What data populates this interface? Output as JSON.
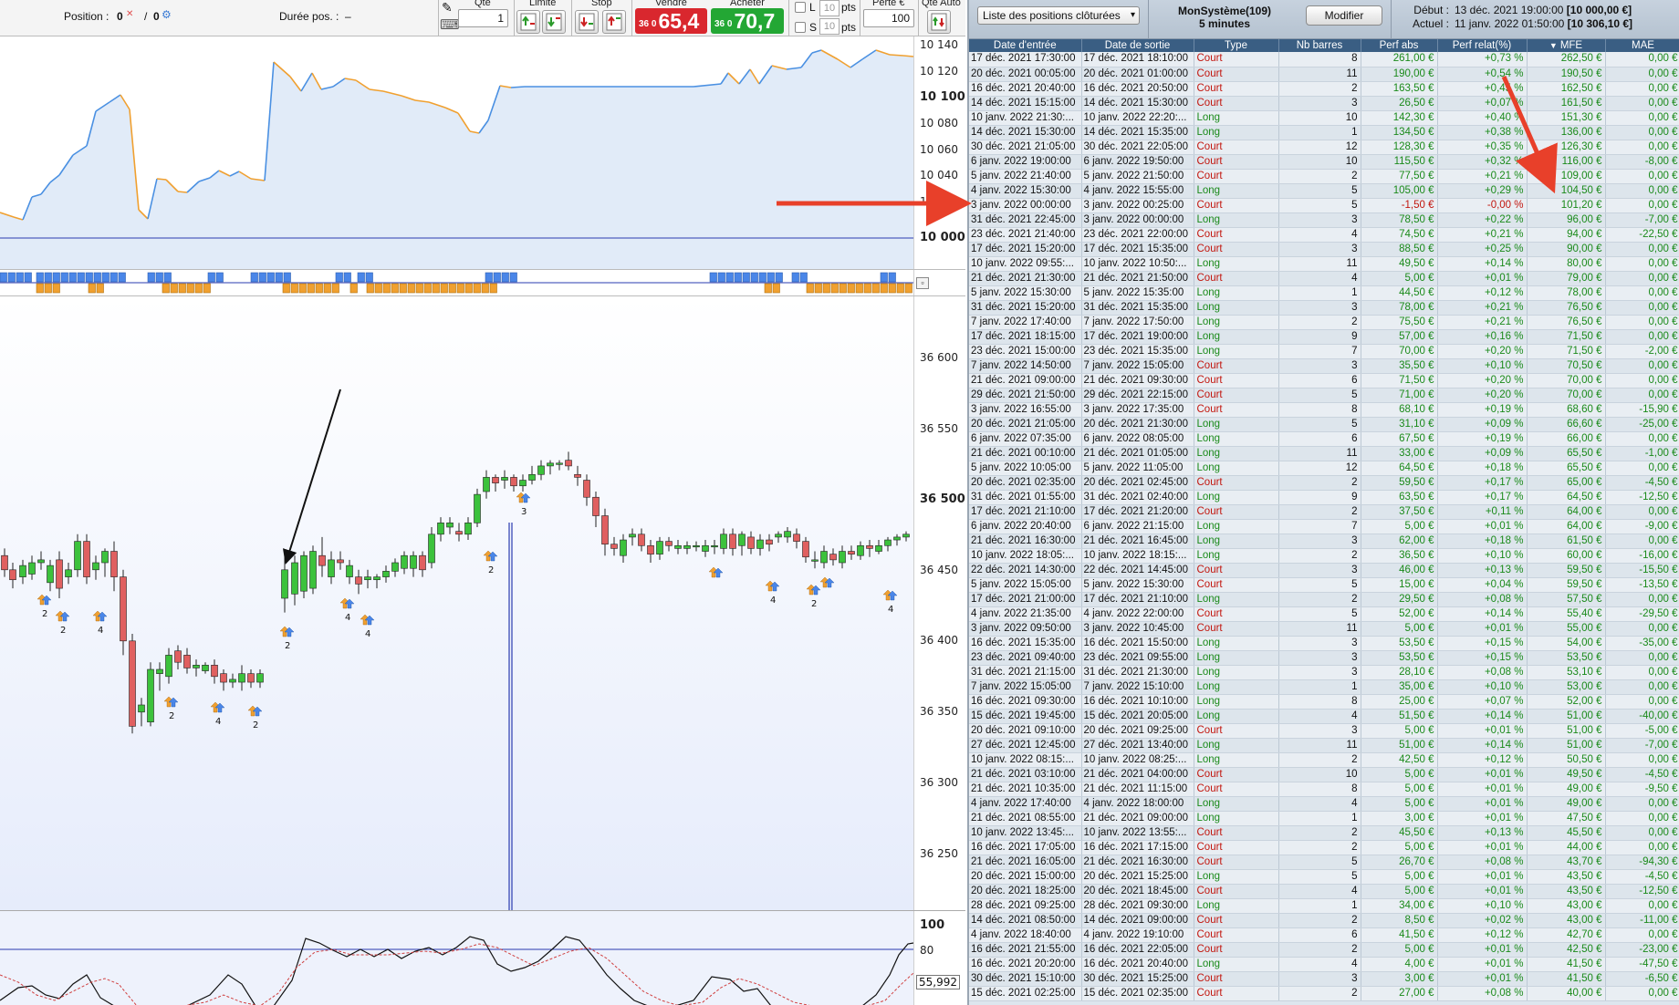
{
  "toolbar": {
    "position_label": "Position :",
    "position_value": "0",
    "position_value2": "0",
    "duration_label": "Durée pos. :",
    "duration_value": "–",
    "qty_label": "Qté",
    "qty_value": "1",
    "limit_label": "Limite",
    "stop_label": "Stop",
    "sell_label": "Vendre",
    "sell_prefix": "36 0",
    "sell_price": "65,4",
    "buy_label": "Acheter",
    "buy_prefix": "36 0",
    "buy_price": "70,7",
    "check_l": "L",
    "check_s": "S",
    "pts_value": "10",
    "pts_label": "pts",
    "loss_label": "Perte €",
    "loss_value": "100",
    "auto_qty_label": "Qté Auto"
  },
  "equity_axis": [
    "10 140",
    "10 120",
    "10 100",
    "10 080",
    "10 060",
    "10 040",
    "10 020",
    "10 000"
  ],
  "price_axis": [
    "36 600",
    "36 550",
    "36 500",
    "36 450",
    "36 400",
    "36 350",
    "36 300",
    "36 250"
  ],
  "osc_axis": [
    "100",
    "80"
  ],
  "osc_value": "55,992",
  "panel": {
    "list_select": "Liste des positions clôturées",
    "system_name": "MonSystème(109)",
    "timeframe": "5 minutes",
    "modify_label": "Modifier",
    "start_label": "Début :",
    "start_value": "13 déc. 2021 19:00:00",
    "start_capital": "[10 000,00 €]",
    "current_label": "Actuel :",
    "current_value": "11 janv. 2022 01:50:00",
    "current_capital": "[10 306,10 €]"
  },
  "table": {
    "columns": [
      "Date d'entrée",
      "Date de sortie",
      "Type",
      "Nb barres",
      "Perf abs",
      "Perf relat(%)",
      "MFE",
      "MAE"
    ],
    "sort_indicator": "▼",
    "rows": [
      [
        "17 déc. 2021 17:30:00",
        "17 déc. 2021 18:10:00",
        "Court",
        "8",
        "261,00 €",
        "+0,73 %",
        "262,50 €",
        "0,00 €"
      ],
      [
        "20 déc. 2021 00:05:00",
        "20 déc. 2021 01:00:00",
        "Court",
        "11",
        "190,00 €",
        "+0,54 %",
        "190,50 €",
        "0,00 €"
      ],
      [
        "16 déc. 2021 20:40:00",
        "16 déc. 2021 20:50:00",
        "Court",
        "2",
        "163,50 €",
        "+0,45 %",
        "162,50 €",
        "0,00 €"
      ],
      [
        "14 déc. 2021 15:15:00",
        "14 déc. 2021 15:30:00",
        "Court",
        "3",
        "26,50 €",
        "+0,07 %",
        "161,50 €",
        "0,00 €"
      ],
      [
        "10 janv. 2022 21:30:...",
        "10 janv. 2022 22:20:...",
        "Long",
        "10",
        "142,30 €",
        "+0,40 %",
        "151,30 €",
        "0,00 €"
      ],
      [
        "14 déc. 2021 15:30:00",
        "14 déc. 2021 15:35:00",
        "Long",
        "1",
        "134,50 €",
        "+0,38 %",
        "136,00 €",
        "0,00 €"
      ],
      [
        "30 déc. 2021 21:05:00",
        "30 déc. 2021 22:05:00",
        "Court",
        "12",
        "128,30 €",
        "+0,35 %",
        "126,30 €",
        "0,00 €"
      ],
      [
        "6 janv. 2022 19:00:00",
        "6 janv. 2022 19:50:00",
        "Court",
        "10",
        "115,50 €",
        "+0,32 %",
        "116,00 €",
        "-8,00 €"
      ],
      [
        "5 janv. 2022 21:40:00",
        "5 janv. 2022 21:50:00",
        "Court",
        "2",
        "77,50 €",
        "+0,21 %",
        "109,00 €",
        "0,00 €"
      ],
      [
        "4 janv. 2022 15:30:00",
        "4 janv. 2022 15:55:00",
        "Long",
        "5",
        "105,00 €",
        "+0,29 %",
        "104,50 €",
        "0,00 €"
      ],
      [
        "3 janv. 2022 00:00:00",
        "3 janv. 2022 00:25:00",
        "Court",
        "5",
        "-1,50 €",
        "-0,00 %",
        "101,20 €",
        "0,00 €"
      ],
      [
        "31 déc. 2021 22:45:00",
        "3 janv. 2022 00:00:00",
        "Long",
        "3",
        "78,50 €",
        "+0,22 %",
        "96,00 €",
        "-7,00 €"
      ],
      [
        "23 déc. 2021 21:40:00",
        "23 déc. 2021 22:00:00",
        "Court",
        "4",
        "74,50 €",
        "+0,21 %",
        "94,00 €",
        "-22,50 €"
      ],
      [
        "17 déc. 2021 15:20:00",
        "17 déc. 2021 15:35:00",
        "Court",
        "3",
        "88,50 €",
        "+0,25 %",
        "90,00 €",
        "0,00 €"
      ],
      [
        "10 janv. 2022 09:55:...",
        "10 janv. 2022 10:50:...",
        "Long",
        "11",
        "49,50 €",
        "+0,14 %",
        "80,00 €",
        "0,00 €"
      ],
      [
        "21 déc. 2021 21:30:00",
        "21 déc. 2021 21:50:00",
        "Court",
        "4",
        "5,00 €",
        "+0,01 %",
        "79,00 €",
        "0,00 €"
      ],
      [
        "5 janv. 2022 15:30:00",
        "5 janv. 2022 15:35:00",
        "Long",
        "1",
        "44,50 €",
        "+0,12 %",
        "78,00 €",
        "0,00 €"
      ],
      [
        "31 déc. 2021 15:20:00",
        "31 déc. 2021 15:35:00",
        "Long",
        "3",
        "78,00 €",
        "+0,21 %",
        "76,50 €",
        "0,00 €"
      ],
      [
        "7 janv. 2022 17:40:00",
        "7 janv. 2022 17:50:00",
        "Long",
        "2",
        "75,50 €",
        "+0,21 %",
        "76,50 €",
        "0,00 €"
      ],
      [
        "17 déc. 2021 18:15:00",
        "17 déc. 2021 19:00:00",
        "Long",
        "9",
        "57,00 €",
        "+0,16 %",
        "71,50 €",
        "0,00 €"
      ],
      [
        "23 déc. 2021 15:00:00",
        "23 déc. 2021 15:35:00",
        "Long",
        "7",
        "70,00 €",
        "+0,20 %",
        "71,50 €",
        "-2,00 €"
      ],
      [
        "7 janv. 2022 14:50:00",
        "7 janv. 2022 15:05:00",
        "Court",
        "3",
        "35,50 €",
        "+0,10 %",
        "70,50 €",
        "0,00 €"
      ],
      [
        "21 déc. 2021 09:00:00",
        "21 déc. 2021 09:30:00",
        "Court",
        "6",
        "71,50 €",
        "+0,20 %",
        "70,00 €",
        "0,00 €"
      ],
      [
        "29 déc. 2021 21:50:00",
        "29 déc. 2021 22:15:00",
        "Court",
        "5",
        "71,00 €",
        "+0,20 %",
        "70,00 €",
        "0,00 €"
      ],
      [
        "3 janv. 2022 16:55:00",
        "3 janv. 2022 17:35:00",
        "Court",
        "8",
        "68,10 €",
        "+0,19 %",
        "68,60 €",
        "-15,90 €"
      ],
      [
        "20 déc. 2021 21:05:00",
        "20 déc. 2021 21:30:00",
        "Long",
        "5",
        "31,10 €",
        "+0,09 %",
        "66,60 €",
        "-25,00 €"
      ],
      [
        "6 janv. 2022 07:35:00",
        "6 janv. 2022 08:05:00",
        "Long",
        "6",
        "67,50 €",
        "+0,19 %",
        "66,00 €",
        "0,00 €"
      ],
      [
        "21 déc. 2021 00:10:00",
        "21 déc. 2021 01:05:00",
        "Long",
        "11",
        "33,00 €",
        "+0,09 %",
        "65,50 €",
        "-1,00 €"
      ],
      [
        "5 janv. 2022 10:05:00",
        "5 janv. 2022 11:05:00",
        "Long",
        "12",
        "64,50 €",
        "+0,18 %",
        "65,50 €",
        "0,00 €"
      ],
      [
        "20 déc. 2021 02:35:00",
        "20 déc. 2021 02:45:00",
        "Court",
        "2",
        "59,50 €",
        "+0,17 %",
        "65,00 €",
        "-4,50 €"
      ],
      [
        "31 déc. 2021 01:55:00",
        "31 déc. 2021 02:40:00",
        "Long",
        "9",
        "63,50 €",
        "+0,17 %",
        "64,50 €",
        "-12,50 €"
      ],
      [
        "17 déc. 2021 21:10:00",
        "17 déc. 2021 21:20:00",
        "Court",
        "2",
        "37,50 €",
        "+0,11 %",
        "64,00 €",
        "0,00 €"
      ],
      [
        "6 janv. 2022 20:40:00",
        "6 janv. 2022 21:15:00",
        "Long",
        "7",
        "5,00 €",
        "+0,01 %",
        "64,00 €",
        "-9,00 €"
      ],
      [
        "21 déc. 2021 16:30:00",
        "21 déc. 2021 16:45:00",
        "Long",
        "3",
        "62,00 €",
        "+0,18 %",
        "61,50 €",
        "0,00 €"
      ],
      [
        "10 janv. 2022 18:05:...",
        "10 janv. 2022 18:15:...",
        "Long",
        "2",
        "36,50 €",
        "+0,10 %",
        "60,00 €",
        "-16,00 €"
      ],
      [
        "22 déc. 2021 14:30:00",
        "22 déc. 2021 14:45:00",
        "Court",
        "3",
        "46,00 €",
        "+0,13 %",
        "59,50 €",
        "-15,50 €"
      ],
      [
        "5 janv. 2022 15:05:00",
        "5 janv. 2022 15:30:00",
        "Court",
        "5",
        "15,00 €",
        "+0,04 %",
        "59,50 €",
        "-13,50 €"
      ],
      [
        "17 déc. 2021 21:00:00",
        "17 déc. 2021 21:10:00",
        "Long",
        "2",
        "29,50 €",
        "+0,08 %",
        "57,50 €",
        "0,00 €"
      ],
      [
        "4 janv. 2022 21:35:00",
        "4 janv. 2022 22:00:00",
        "Court",
        "5",
        "52,00 €",
        "+0,14 %",
        "55,40 €",
        "-29,50 €"
      ],
      [
        "3 janv. 2022 09:50:00",
        "3 janv. 2022 10:45:00",
        "Court",
        "11",
        "5,00 €",
        "+0,01 %",
        "55,00 €",
        "0,00 €"
      ],
      [
        "16 déc. 2021 15:35:00",
        "16 déc. 2021 15:50:00",
        "Long",
        "3",
        "53,50 €",
        "+0,15 %",
        "54,00 €",
        "-35,00 €"
      ],
      [
        "23 déc. 2021 09:40:00",
        "23 déc. 2021 09:55:00",
        "Long",
        "3",
        "53,50 €",
        "+0,15 %",
        "53,50 €",
        "0,00 €"
      ],
      [
        "31 déc. 2021 21:15:00",
        "31 déc. 2021 21:30:00",
        "Long",
        "3",
        "28,10 €",
        "+0,08 %",
        "53,10 €",
        "0,00 €"
      ],
      [
        "7 janv. 2022 15:05:00",
        "7 janv. 2022 15:10:00",
        "Long",
        "1",
        "35,00 €",
        "+0,10 %",
        "53,00 €",
        "0,00 €"
      ],
      [
        "16 déc. 2021 09:30:00",
        "16 déc. 2021 10:10:00",
        "Long",
        "8",
        "25,00 €",
        "+0,07 %",
        "52,00 €",
        "0,00 €"
      ],
      [
        "15 déc. 2021 19:45:00",
        "15 déc. 2021 20:05:00",
        "Long",
        "4",
        "51,50 €",
        "+0,14 %",
        "51,00 €",
        "-40,00 €"
      ],
      [
        "20 déc. 2021 09:10:00",
        "20 déc. 2021 09:25:00",
        "Court",
        "3",
        "5,00 €",
        "+0,01 %",
        "51,00 €",
        "-5,00 €"
      ],
      [
        "27 déc. 2021 12:45:00",
        "27 déc. 2021 13:40:00",
        "Long",
        "11",
        "51,00 €",
        "+0,14 %",
        "51,00 €",
        "-7,00 €"
      ],
      [
        "10 janv. 2022 08:15:...",
        "10 janv. 2022 08:25:...",
        "Long",
        "2",
        "42,50 €",
        "+0,12 %",
        "50,50 €",
        "0,00 €"
      ],
      [
        "21 déc. 2021 03:10:00",
        "21 déc. 2021 04:00:00",
        "Court",
        "10",
        "5,00 €",
        "+0,01 %",
        "49,50 €",
        "-4,50 €"
      ],
      [
        "21 déc. 2021 10:35:00",
        "21 déc. 2021 11:15:00",
        "Court",
        "8",
        "5,00 €",
        "+0,01 %",
        "49,00 €",
        "-9,50 €"
      ],
      [
        "4 janv. 2022 17:40:00",
        "4 janv. 2022 18:00:00",
        "Long",
        "4",
        "5,00 €",
        "+0,01 %",
        "49,00 €",
        "0,00 €"
      ],
      [
        "21 déc. 2021 08:55:00",
        "21 déc. 2021 09:00:00",
        "Long",
        "1",
        "3,00 €",
        "+0,01 %",
        "47,50 €",
        "0,00 €"
      ],
      [
        "10 janv. 2022 13:45:...",
        "10 janv. 2022 13:55:...",
        "Court",
        "2",
        "45,50 €",
        "+0,13 %",
        "45,50 €",
        "0,00 €"
      ],
      [
        "16 déc. 2021 17:05:00",
        "16 déc. 2021 17:15:00",
        "Court",
        "2",
        "5,00 €",
        "+0,01 %",
        "44,00 €",
        "0,00 €"
      ],
      [
        "21 déc. 2021 16:05:00",
        "21 déc. 2021 16:30:00",
        "Court",
        "5",
        "26,70 €",
        "+0,08 %",
        "43,70 €",
        "-94,30 €"
      ],
      [
        "20 déc. 2021 15:00:00",
        "20 déc. 2021 15:25:00",
        "Long",
        "5",
        "5,00 €",
        "+0,01 %",
        "43,50 €",
        "-4,50 €"
      ],
      [
        "20 déc. 2021 18:25:00",
        "20 déc. 2021 18:45:00",
        "Court",
        "4",
        "5,00 €",
        "+0,01 %",
        "43,50 €",
        "-12,50 €"
      ],
      [
        "28 déc. 2021 09:25:00",
        "28 déc. 2021 09:30:00",
        "Long",
        "1",
        "34,00 €",
        "+0,10 %",
        "43,00 €",
        "0,00 €"
      ],
      [
        "14 déc. 2021 08:50:00",
        "14 déc. 2021 09:00:00",
        "Court",
        "2",
        "8,50 €",
        "+0,02 %",
        "43,00 €",
        "-11,00 €"
      ],
      [
        "4 janv. 2022 18:40:00",
        "4 janv. 2022 19:10:00",
        "Court",
        "6",
        "41,50 €",
        "+0,12 %",
        "42,70 €",
        "0,00 €"
      ],
      [
        "16 déc. 2021 21:55:00",
        "16 déc. 2021 22:05:00",
        "Court",
        "2",
        "5,00 €",
        "+0,01 %",
        "42,50 €",
        "-23,00 €"
      ],
      [
        "16 déc. 2021 20:20:00",
        "16 déc. 2021 20:40:00",
        "Long",
        "4",
        "4,00 €",
        "+0,01 %",
        "41,50 €",
        "-47,50 €"
      ],
      [
        "30 déc. 2021 15:10:00",
        "30 déc. 2021 15:25:00",
        "Court",
        "3",
        "3,00 €",
        "+0,01 %",
        "41,50 €",
        "-6,50 €"
      ],
      [
        "15 déc. 2021 02:25:00",
        "15 déc. 2021 02:35:00",
        "Court",
        "2",
        "27,00 €",
        "+0,08 %",
        "40,00 €",
        "0,00 €"
      ]
    ]
  },
  "colors": {
    "equity_line_up": "#4a90e2",
    "equity_line_down": "#f0a030",
    "equity_fill": "#dce8f7",
    "candle_up": "#3cc23c",
    "candle_down": "#e06060",
    "signal_blue": "#4a86e8",
    "signal_orange": "#f0a030",
    "court": "#c2160e",
    "long": "#1a8a1a",
    "arrow_red": "#e8402a",
    "sell_bg": "#d9272e",
    "buy_bg": "#23a734",
    "header_bg": "#3a5e83"
  }
}
